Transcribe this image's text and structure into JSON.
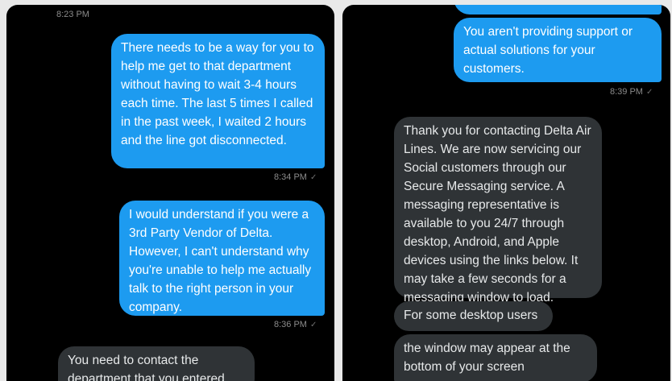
{
  "left": {
    "top_time": "8:23 PM",
    "messages": [
      {
        "text": "There needs to be a way for you to help me get to that department without having to wait 3-4 hours each time. The last 5 times I called in the past week, I waited 2 hours and the line got disconnected.",
        "time": "8:34 PM",
        "status": "✓"
      },
      {
        "text": "I would understand if you were a 3rd Party Vendor of Delta. However, I can't understand why you're unable to help me actually talk to the right person in your company.",
        "time": "8:36 PM",
        "status": "✓"
      },
      {
        "text": "You need to contact the department that you entered"
      }
    ]
  },
  "right": {
    "messages": [
      {
        "text": "You aren't providing support or actual solutions for your customers.",
        "time": "8:39 PM",
        "status": "✓"
      },
      {
        "text": "Thank you for contacting Delta Air Lines. We are now servicing our Social customers through our Secure Messaging service. A messaging representative is available to you 24/7 through desktop, Android, and Apple devices using the links below. It may take a few seconds for a messaging window to load."
      },
      {
        "text": "For some desktop users"
      },
      {
        "text": "the window may appear at the bottom of your screen"
      }
    ]
  }
}
